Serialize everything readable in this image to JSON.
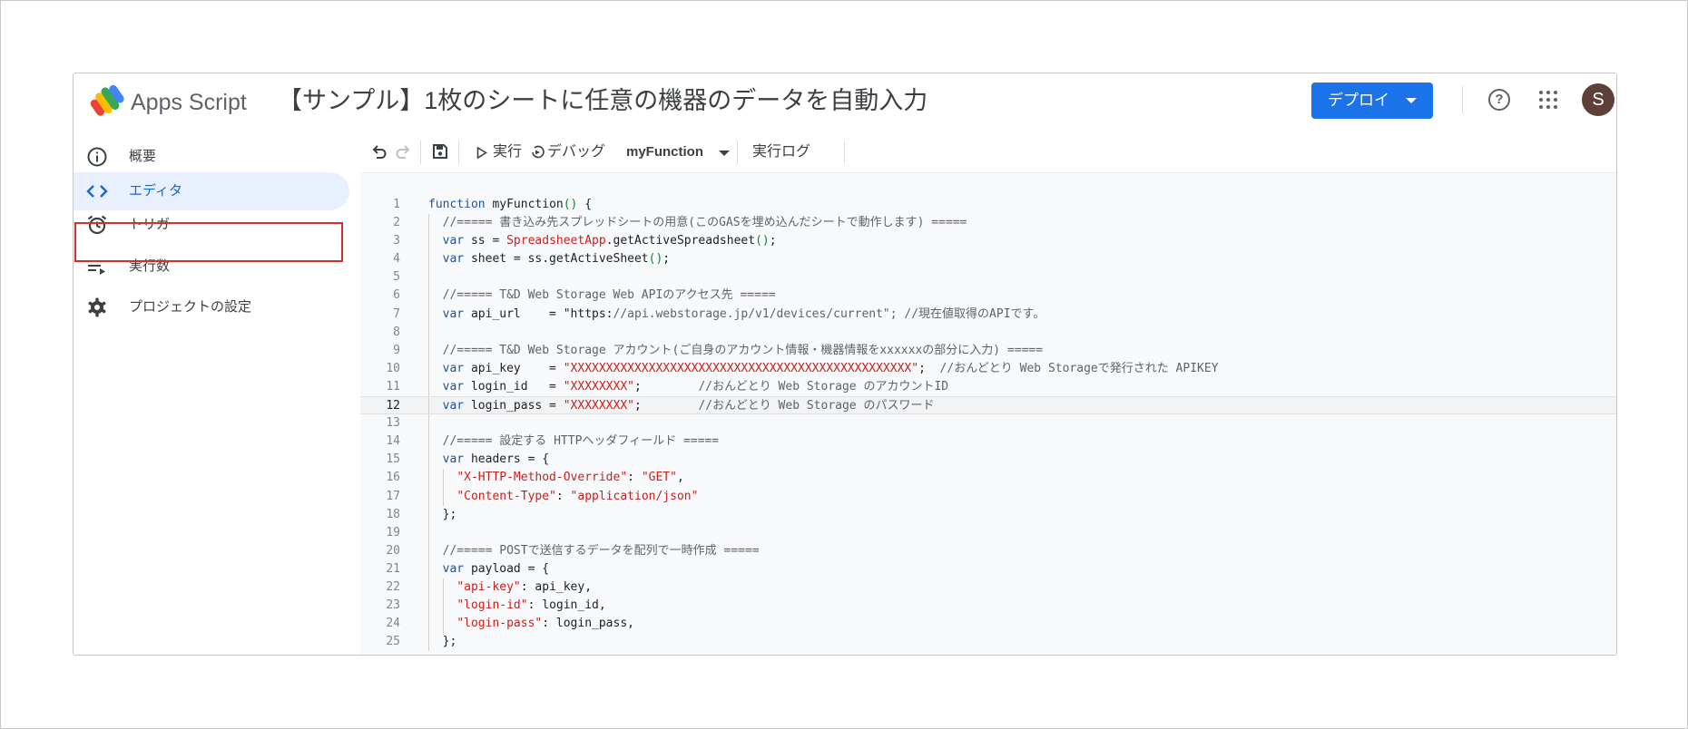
{
  "header": {
    "app_name": "Apps Script",
    "project_title": "【サンプル】1枚のシートに任意の機器のデータを自動入力",
    "deploy_label": "デプロイ",
    "help_glyph": "?",
    "avatar_initial": "S"
  },
  "sidebar": {
    "items": [
      {
        "label": "概要",
        "icon": "info-icon"
      },
      {
        "label": "エディタ",
        "icon": "code-icon",
        "active": true
      },
      {
        "label": "トリガー",
        "icon": "alarm-clock-icon",
        "highlighted": true
      },
      {
        "label": "実行数",
        "icon": "executions-list-icon"
      },
      {
        "label": "プロジェクトの設定",
        "icon": "gear-icon"
      }
    ]
  },
  "toolbar": {
    "run_label": "実行",
    "debug_label": "デバッグ",
    "function_select": "myFunction",
    "log_label": "実行ログ"
  },
  "editor": {
    "current_line": 12,
    "lines": [
      {
        "n": "1",
        "code": "function myFunction() {"
      },
      {
        "n": "2",
        "code": "  //===== 書き込み先スプレッドシートの用意(このGASを埋め込んだシートで動作します) ====="
      },
      {
        "n": "3",
        "code": "  var ss = SpreadsheetApp.getActiveSpreadsheet();"
      },
      {
        "n": "4",
        "code": "  var sheet = ss.getActiveSheet();"
      },
      {
        "n": "5",
        "code": ""
      },
      {
        "n": "6",
        "code": "  //===== T&D Web Storage Web APIのアクセス先 ====="
      },
      {
        "n": "7",
        "code": "  var api_url    = \"https://api.webstorage.jp/v1/devices/current\"; //現在値取得のAPIです。"
      },
      {
        "n": "8",
        "code": ""
      },
      {
        "n": "9",
        "code": "  //===== T&D Web Storage アカウント(ご自身のアカウント情報・機器情報をxxxxxxの部分に入力) ====="
      },
      {
        "n": "10",
        "code": "  var api_key    = \"XXXXXXXXXXXXXXXXXXXXXXXXXXXXXXXXXXXXXXXXXXXXXXXX\";  //おんどとり Web Storageで発行された APIKEY"
      },
      {
        "n": "11",
        "code": "  var login_id   = \"XXXXXXXX\";        //おんどとり Web Storage のアカウントID"
      },
      {
        "n": "12",
        "code": "  var login_pass = \"XXXXXXXX\";        //おんどとり Web Storage のパスワード"
      },
      {
        "n": "13",
        "code": ""
      },
      {
        "n": "14",
        "code": "  //===== 設定する HTTPヘッダフィールド ====="
      },
      {
        "n": "15",
        "code": "  var headers = {"
      },
      {
        "n": "16",
        "code": "    \"X-HTTP-Method-Override\": \"GET\","
      },
      {
        "n": "17",
        "code": "    \"Content-Type\": \"application/json\""
      },
      {
        "n": "18",
        "code": "  };"
      },
      {
        "n": "19",
        "code": ""
      },
      {
        "n": "20",
        "code": "  //===== POSTで送信するデータを配列で一時作成 ====="
      },
      {
        "n": "21",
        "code": "  var payload = {"
      },
      {
        "n": "22",
        "code": "    \"api-key\": api_key,"
      },
      {
        "n": "23",
        "code": "    \"login-id\": login_id,"
      },
      {
        "n": "24",
        "code": "    \"login-pass\": login_pass,"
      },
      {
        "n": "25",
        "code": "  };"
      }
    ]
  },
  "colors": {
    "accent": "#1a73e8",
    "active_nav_bg": "#e8f0fe",
    "highlight_border": "#d32f2f",
    "avatar_bg": "#5d4037"
  }
}
